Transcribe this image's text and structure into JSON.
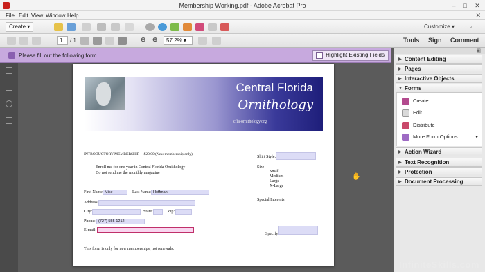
{
  "window": {
    "title": "Membership Working.pdf - Adobe Acrobat Pro"
  },
  "menu": [
    "File",
    "Edit",
    "View",
    "Window",
    "Help"
  ],
  "toolbar": {
    "create_label": "Create",
    "customize_label": "Customize",
    "tabs": [
      "Tools",
      "Sign",
      "Comment"
    ],
    "page_current": "1",
    "page_total": "/ 1",
    "zoom": "57.2%"
  },
  "notice": {
    "message": "Please fill out the following form.",
    "highlight_label": "Highlight Existing Fields"
  },
  "document": {
    "banner_title": "Central Florida",
    "banner_subtitle": "Ornithology",
    "banner_url": "cfla-ornithology.org",
    "heading": "INTRODUCTORY MEMBERSHIP —$20.00 (New membership only)",
    "option1": "Enroll me for one year in Central Florida Ornithology",
    "option2": "Do not send me the monthly magazine",
    "first_name_label": "First Name:",
    "first_name_value": "Mike",
    "last_name_label": "Last Name:",
    "last_name_value": "Hoffman",
    "address_label": "Address:",
    "city_label": "City:",
    "state_label": "State:",
    "zip_label": "Zip:",
    "phone_label": "Phone:",
    "phone_value": "(727) 555-1212",
    "email_label": "E-mail:",
    "footer_note": "This form is only for new memberships, not renewals.",
    "shirt_style_label": "Shirt Style:",
    "size_label": "Size",
    "sizes": [
      "Small",
      "Medium",
      "Large",
      "X-Large"
    ],
    "special_interests_label": "Special Interests",
    "specify_label": "Specify:"
  },
  "panel": {
    "sections_top": [
      "Content Editing",
      "Pages",
      "Interactive Objects",
      "Forms"
    ],
    "forms_items": [
      "Create",
      "Edit",
      "Distribute",
      "More Form Options"
    ],
    "sections_bottom": [
      "Action Wizard",
      "Text Recognition",
      "Protection",
      "Document Processing"
    ]
  },
  "watermark": "InfiniteSkills.com",
  "colors": {
    "notice_bar": "#c7a9de",
    "field_fill": "#dcdcf6",
    "required_border": "#c0306a"
  }
}
